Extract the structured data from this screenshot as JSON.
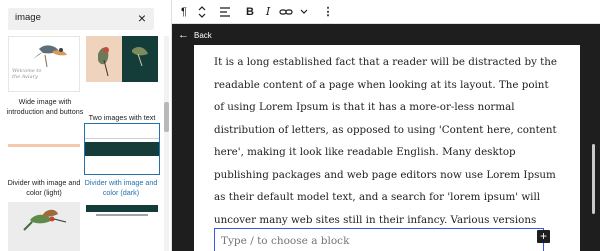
{
  "inserter": {
    "search_value": "image",
    "clear_icon": "×",
    "patterns": [
      {
        "label": "Wide image with introduction and buttons",
        "thumb_text": "Welcome to the Aviary"
      },
      {
        "label": "Two images with text"
      },
      {
        "label": "Divider with image and color (light)"
      },
      {
        "label": "Divider with image and color (dark)"
      }
    ],
    "colors": {
      "dark_green": "#143d3a",
      "peach": "#efd3bc",
      "salmon": "#f6c9ad",
      "active": "#2271b1"
    }
  },
  "toolbar": {
    "paragraph_icon": "¶",
    "bold_label": "B",
    "italic_label": "I",
    "more_label": "⋮"
  },
  "editor": {
    "back_label": "Back",
    "paragraph_text": "It is a long established fact that a reader will be distracted by the readable content of a page when looking at its layout. The point of using Lorem Ipsum is that it has a more-or-less normal distribution of letters, as opposed to using 'Content here, content here', making it look like readable English. Many desktop publishing packages and web page editors now use Lorem Ipsum as their default model text, and a search for 'lorem ipsum' will uncover many web sites still in their infancy. Various versions have evolved",
    "appender_placeholder": "Type / to choose a block",
    "add_icon": "+"
  }
}
